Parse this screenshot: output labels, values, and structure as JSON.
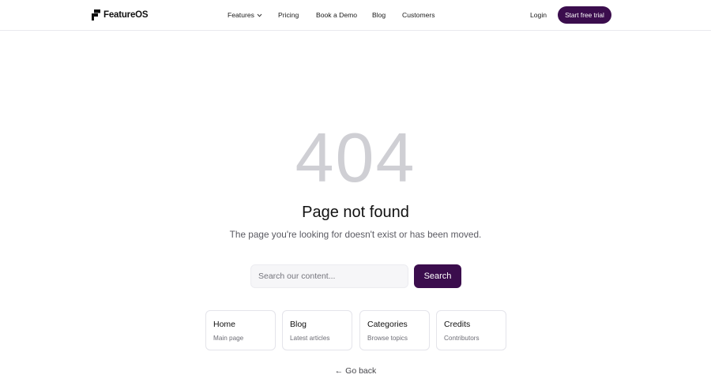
{
  "brand": {
    "name": "FeatureOS",
    "accent": "#3b0d4d"
  },
  "nav": {
    "features": "Features",
    "pricing": "Pricing",
    "book_demo": "Book a Demo",
    "blog": "Blog",
    "customers": "Customers",
    "login": "Login",
    "cta": "Start free trial"
  },
  "error": {
    "code": "404",
    "title": "Page not found",
    "message": "The page you're looking for doesn't exist or has been moved."
  },
  "search": {
    "placeholder": "Search our content...",
    "button": "Search"
  },
  "cards": [
    {
      "title": "Home",
      "desc": "Main page"
    },
    {
      "title": "Blog",
      "desc": "Latest articles"
    },
    {
      "title": "Categories",
      "desc": "Browse topics"
    },
    {
      "title": "Credits",
      "desc": "Contributors"
    }
  ],
  "go_back": "← Go back"
}
